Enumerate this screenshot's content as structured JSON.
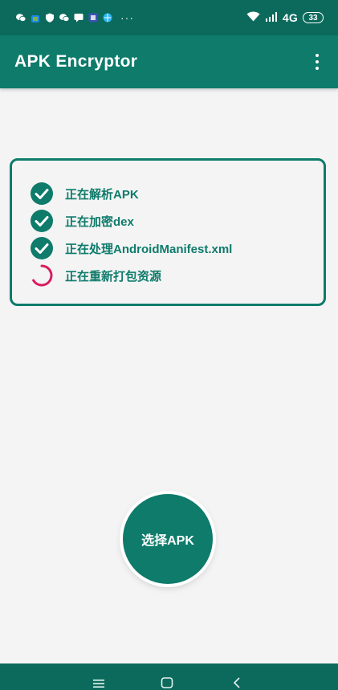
{
  "status_bar": {
    "icons": [
      "wechat-icon",
      "shopping-bag-icon",
      "shield-icon",
      "wechat-icon",
      "message-icon",
      "app-icon",
      "browser-icon"
    ],
    "more": "···",
    "network": "4G",
    "battery": "33"
  },
  "app_bar": {
    "title": "APK Encryptor"
  },
  "progress": {
    "steps": [
      {
        "label": "正在解析APK",
        "state": "done"
      },
      {
        "label": "正在加密dex",
        "state": "done"
      },
      {
        "label": "正在处理AndroidManifest.xml",
        "state": "done"
      },
      {
        "label": "正在重新打包资源",
        "state": "in-progress"
      }
    ]
  },
  "fab": {
    "label": "选择APK"
  },
  "colors": {
    "primary": "#0e7b6b",
    "status_bar": "#0b6a5c",
    "spinner": "#d81b60",
    "background": "#f4f4f4"
  }
}
